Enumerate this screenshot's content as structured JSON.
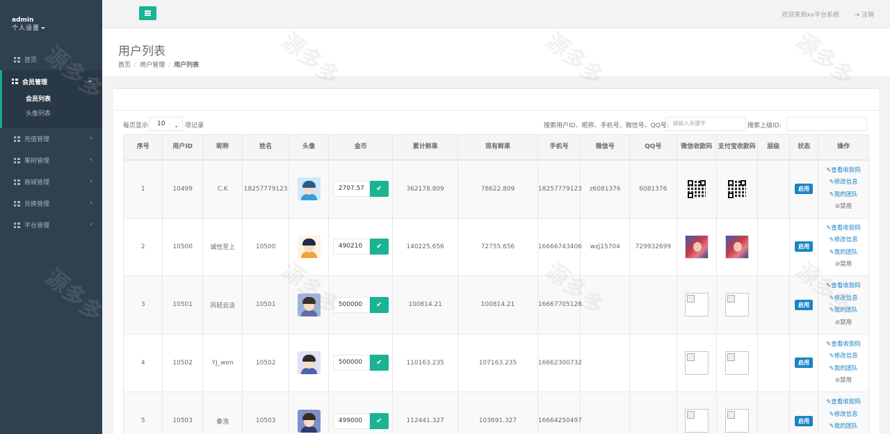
{
  "profile": {
    "username": "admin",
    "settings_label": "个人设置"
  },
  "sidebar": {
    "home": "首页",
    "member": "会员管理",
    "member_sub": [
      "会员列表",
      "头像列表"
    ],
    "items_after": [
      "充值管理",
      "果树管理",
      "商城管理",
      "兑换管理",
      "平台管理"
    ]
  },
  "topbar": {
    "welcome": "欢迎来到xx平台系统",
    "logout": "注销"
  },
  "heading": {
    "title": "用户列表",
    "crumb_home": "首页",
    "crumb_parent": "用户管理",
    "crumb_current": "用户列表"
  },
  "toolbar": {
    "length_prefix": "每页显示",
    "length_value": "10",
    "length_suffix": "项记录",
    "search_label": "搜索用户ID、昵称、手机号、微信号、QQ号:",
    "search_placeholder": "请输入关键字",
    "parent_label": "搜索上级ID:"
  },
  "table": {
    "headers": [
      "序号",
      "用户ID",
      "昵称",
      "姓名",
      "头像",
      "金币",
      "累计鲜果",
      "现有鲜果",
      "手机号",
      "微信号",
      "QQ号",
      "微信收款码",
      "支付宝收款码",
      "层级",
      "状态",
      "操作"
    ],
    "actions": [
      "查看收款码",
      "修改信息",
      "我的团队",
      "禁用"
    ],
    "status_label": "启用",
    "rows": [
      {
        "no": "1",
        "uid": "10499",
        "nick": "C.K",
        "name": "18257779123",
        "coin": "2707.57",
        "total_fruit": "362178.809",
        "current_fruit": "78622.809",
        "phone": "18257779123",
        "wechat": "z6081376",
        "qq": "6081376",
        "wx_code": "qr",
        "ali_code": "qr",
        "level": ""
      },
      {
        "no": "2",
        "uid": "10500",
        "nick": "诚信至上",
        "name": "10500",
        "coin": "490210",
        "total_fruit": "140225.656",
        "current_fruit": "72755.656",
        "phone": "16666743406",
        "wechat": "wzj15704",
        "qq": "729932699",
        "wx_code": "photo",
        "ali_code": "photo",
        "level": ""
      },
      {
        "no": "3",
        "uid": "10501",
        "nick": "风轻云淡",
        "name": "10501",
        "coin": "500000",
        "total_fruit": "100814.21",
        "current_fruit": "100814.21",
        "phone": "16667705128",
        "wechat": "",
        "qq": "",
        "wx_code": "broken",
        "ali_code": "broken",
        "level": ""
      },
      {
        "no": "4",
        "uid": "10502",
        "nick": "YJ_wen",
        "name": "10502",
        "coin": "500000",
        "total_fruit": "110163.235",
        "current_fruit": "107163.235",
        "phone": "16662300732",
        "wechat": "",
        "qq": "",
        "wx_code": "broken",
        "ali_code": "broken",
        "level": ""
      },
      {
        "no": "5",
        "uid": "10503",
        "nick": "秦浩",
        "name": "10503",
        "coin": "499000",
        "total_fruit": "112441.327",
        "current_fruit": "103691.327",
        "phone": "16664250497",
        "wechat": "",
        "qq": "",
        "wx_code": "broken",
        "ali_code": "broken",
        "level": ""
      }
    ]
  },
  "colors": {
    "sidebar_bg": "#2f4050",
    "accent": "#1ab394",
    "link": "#1c84c6"
  },
  "icons": [
    "menu-icon",
    "logout-icon",
    "grid-icon",
    "chevron-down-icon",
    "chevron-left-icon",
    "check-icon",
    "edit-icon",
    "ban-icon"
  ]
}
